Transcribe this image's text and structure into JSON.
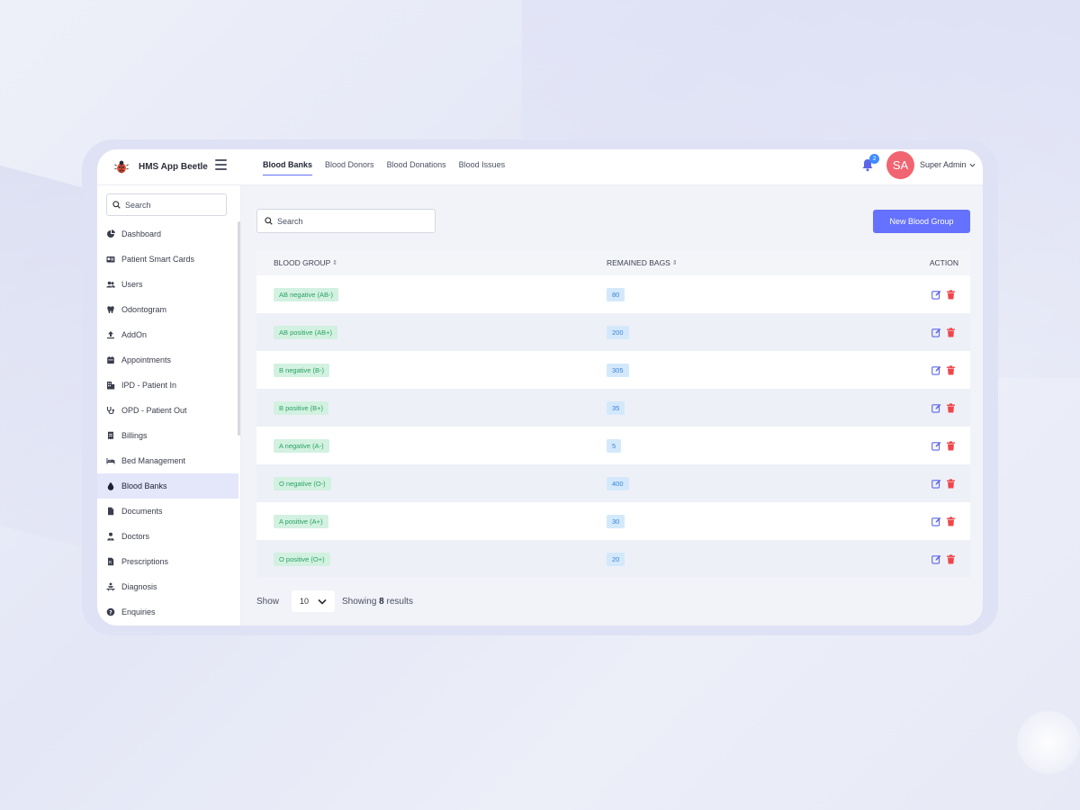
{
  "app": {
    "brand_name": "HMS App Beetle",
    "nav_tabs": [
      {
        "label": "Blood Banks"
      },
      {
        "label": "Blood Donors"
      },
      {
        "label": "Blood Donations"
      },
      {
        "label": "Blood Issues"
      }
    ],
    "notifications_count": "2",
    "avatar_initials": "SA",
    "user_name": "Super Admin"
  },
  "sidebar": {
    "search_placeholder": "Search",
    "items": [
      {
        "label": "Dashboard",
        "icon": "dashboard-icon"
      },
      {
        "label": "Patient Smart Cards",
        "icon": "id-card-icon"
      },
      {
        "label": "Users",
        "icon": "users-icon"
      },
      {
        "label": "Odontogram",
        "icon": "tooth-icon"
      },
      {
        "label": "AddOn",
        "icon": "upload-icon"
      },
      {
        "label": "Appointments",
        "icon": "calendar-icon"
      },
      {
        "label": "IPD - Patient In",
        "icon": "hospital-icon"
      },
      {
        "label": "OPD - Patient Out",
        "icon": "stethoscope-icon"
      },
      {
        "label": "Billings",
        "icon": "receipt-icon"
      },
      {
        "label": "Bed Management",
        "icon": "bed-icon"
      },
      {
        "label": "Blood Banks",
        "icon": "blood-drop-icon",
        "active": true
      },
      {
        "label": "Documents",
        "icon": "document-icon"
      },
      {
        "label": "Doctors",
        "icon": "doctor-icon"
      },
      {
        "label": "Prescriptions",
        "icon": "prescription-icon"
      },
      {
        "label": "Diagnosis",
        "icon": "diagnosis-icon"
      },
      {
        "label": "Enquiries",
        "icon": "question-icon"
      }
    ]
  },
  "main": {
    "search_placeholder": "Search",
    "new_button_label": "New Blood Group",
    "columns": {
      "blood_group": "BLOOD GROUP",
      "remained_bags": "REMAINED BAGS",
      "action": "ACTION",
      "sort_glyph": "⇕"
    },
    "rows": [
      {
        "group": "AB negative (AB-)",
        "bags": "80"
      },
      {
        "group": "AB positive (AB+)",
        "bags": "200"
      },
      {
        "group": "B negative (B-)",
        "bags": "305"
      },
      {
        "group": "B positive (B+)",
        "bags": "35"
      },
      {
        "group": "A negative (A-)",
        "bags": "5"
      },
      {
        "group": "O negative (O-)",
        "bags": "400"
      },
      {
        "group": "A positive (A+)",
        "bags": "30"
      },
      {
        "group": "O positive (O+)",
        "bags": "20"
      }
    ],
    "footer": {
      "show_label": "Show",
      "page_size": "10",
      "showing_prefix": "Showing",
      "result_count": "8",
      "showing_suffix": "results"
    }
  },
  "colors": {
    "accent": "#6571ff",
    "danger": "#f0464b",
    "success_pill_bg": "#d2f1e0",
    "success_pill_text": "#29a266",
    "info_pill_bg": "#d3e9fb",
    "info_pill_text": "#3983d6",
    "avatar_bg": "#f06571"
  }
}
